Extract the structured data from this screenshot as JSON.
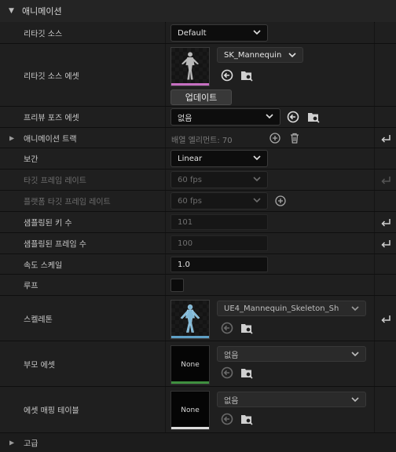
{
  "category": {
    "title": "애니메이션"
  },
  "rows": {
    "retarget_source": {
      "label": "리타깃 소스",
      "value": "Default"
    },
    "retarget_source_asset": {
      "label": "리타깃 소스 에셋",
      "value": "SK_Mannequin",
      "update_button": "업데이트"
    },
    "preview_pose_asset": {
      "label": "프리뷰 포즈 에셋",
      "value": "없음"
    },
    "animation_track": {
      "label": "애니메이션 트랙",
      "hint": "배열 엘리먼트: 70"
    },
    "interpolation": {
      "label": "보간",
      "value": "Linear"
    },
    "target_frame_rate": {
      "label": "타깃 프레임 레이트",
      "value": "60 fps"
    },
    "platform_target_frame_rate": {
      "label": "플랫폼 타깃 프레임 레이트",
      "value": "60 fps"
    },
    "sampled_keys": {
      "label": "샘플링된 키 수",
      "value": "101"
    },
    "sampled_frames": {
      "label": "샘플링된 프레임 수",
      "value": "100"
    },
    "rate_scale": {
      "label": "속도 스케일",
      "value": "1.0"
    },
    "loop": {
      "label": "루프",
      "checked": false
    },
    "skeleton": {
      "label": "스켈레톤",
      "value": "UE4_Mannequin_Skeleton_Sh"
    },
    "parent_asset": {
      "label": "부모 에셋",
      "value": "없음",
      "thumb_text": "None"
    },
    "asset_mapping_table": {
      "label": "에셋 매핑 테이블",
      "value": "없음",
      "thumb_text": "None"
    }
  },
  "advanced": {
    "label": "고급"
  },
  "colors": {
    "mesh_strip": "#c66fc1",
    "skeleton_strip": "#5fa0c6",
    "parent_strip": "#3f8f3f",
    "mapping_strip": "#dcdcdc"
  }
}
